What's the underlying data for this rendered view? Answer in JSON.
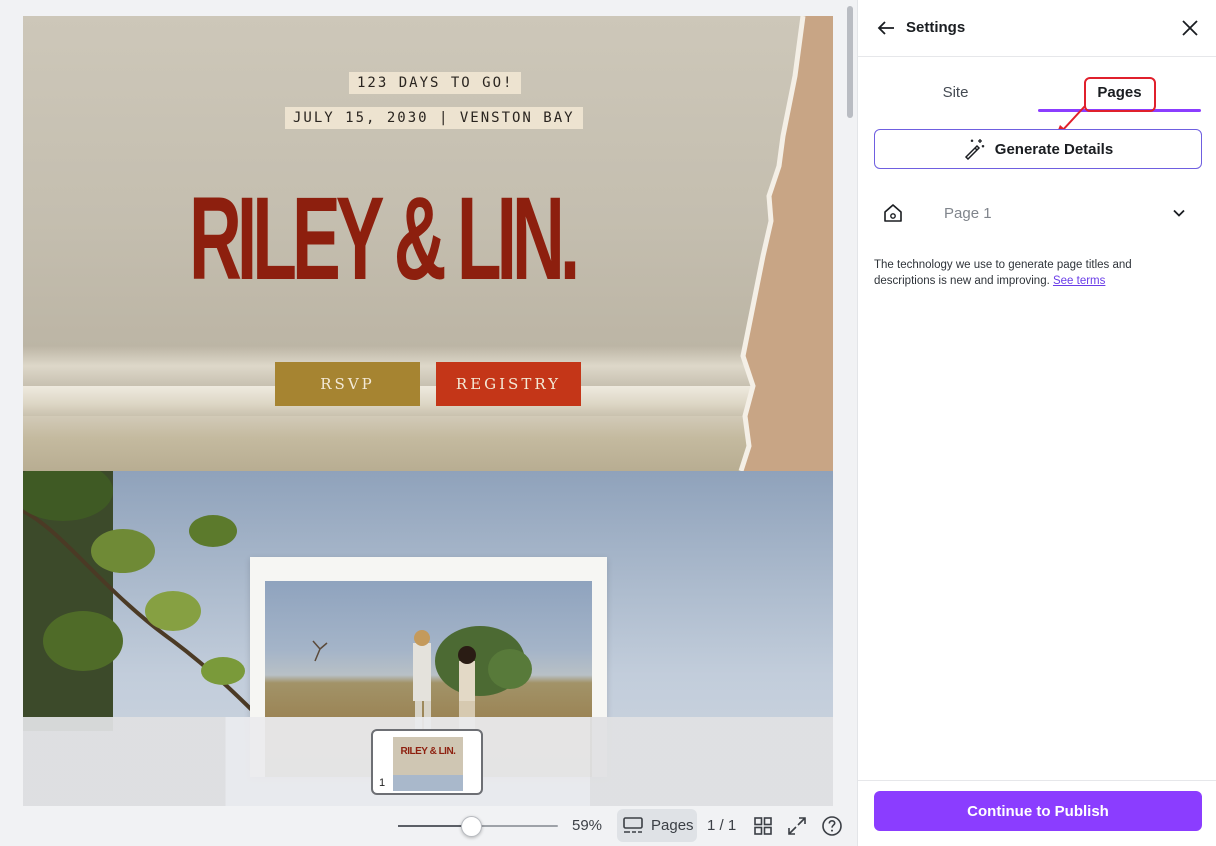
{
  "canvas": {
    "hero": {
      "countdown": "123 DAYS TO GO!",
      "date_place": "JULY 15, 2030 | VENSTON BAY",
      "title": "RILEY & LIN.",
      "rsvp_label": "RSVP",
      "registry_label": "REGISTRY"
    },
    "thumbnail": {
      "title": "RILEY & LIN.",
      "page_number": "1"
    }
  },
  "bottom_bar": {
    "zoom_value": "59%",
    "zoom_percent": 59,
    "pages_label": "Pages",
    "page_count": "1 / 1"
  },
  "panel": {
    "title": "Settings",
    "tabs": [
      {
        "label": "Site",
        "active": false
      },
      {
        "label": "Pages",
        "active": true
      }
    ],
    "generate_label": "Generate Details",
    "page_row_label": "Page 1",
    "disclaimer_text": "The technology we use to generate page titles and descriptions is new and improving. ",
    "see_terms_label": "See terms",
    "publish_label": "Continue to Publish"
  },
  "colors": {
    "accent": "#8b3dff",
    "title_red": "#8d1f0e",
    "rsvp_gold": "#a68431",
    "registry_red": "#c43618",
    "annotation_red": "#e0202c"
  },
  "icons": [
    "arrow-left-icon",
    "close-icon",
    "magic-wand-icon",
    "home-icon",
    "chevron-down-icon",
    "pages-icon",
    "grid-icon",
    "fullscreen-icon",
    "help-icon"
  ]
}
